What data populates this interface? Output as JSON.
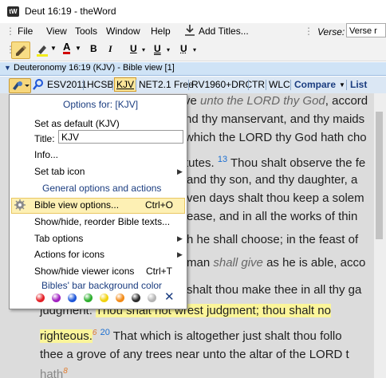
{
  "window": {
    "app_icon": "tW",
    "title": "Deut 16:19 - theWord"
  },
  "menu": {
    "file": "File",
    "view": "View",
    "tools": "Tools",
    "window": "Window",
    "help": "Help",
    "add_titles": "Add Titles...",
    "verse_label": "Verse:",
    "verse_value": "Verse r"
  },
  "toolbar": {
    "bold": "B",
    "italic": "I",
    "underline1": "U",
    "underline2": "U",
    "underline3": "U"
  },
  "doc_tab": {
    "title": "Deuteronomy 16:19 (KJV) - Bible view [1]"
  },
  "bibles": {
    "tabs": [
      "ESV2011",
      "HCSB",
      "KJV",
      "NET2.1 Free",
      "RV1960+DRC",
      "TR",
      "WLC"
    ],
    "active": "KJV",
    "compare": "Compare",
    "list": "List"
  },
  "reading": {
    "l1a": "ve ",
    "l1b": "unto the LORD thy God",
    "l1c": ", accord",
    "l2": "nd thy manservant, and thy maids",
    "l3": "which the LORD thy God hath cho",
    "l4a": "tutes. ",
    "l4n": "13",
    "l4b": " Thou shalt observe the fe",
    "l5": "and thy son, and thy daughter, a",
    "l6": "ven days shalt thou keep a solem",
    "l7": "ease, and in all the works of thin",
    "l8": "h he shall choose; in the feast of",
    "l9a": "man ",
    "l9b": "shall give",
    "l9c": " as he is able, acco",
    "l10": "shalt thou make thee in all thy ga",
    "l11a": "judgment. ",
    "l11b": "Thou shalt not wrest judgment; thou shalt no",
    "l12a": "righteous.",
    "l12s": "6",
    "l12b": " That which is altogether just shalt thou follo",
    "l12n": "20",
    "l13": "thee a grove of any trees near unto the altar of the LORD t",
    "l14a": "hath",
    "l14s": "8"
  },
  "popup": {
    "header": "Options for: [KJV]",
    "set_default": "Set as default (KJV)",
    "title_label": "Title:",
    "title_value": "KJV",
    "info": "Info...",
    "set_tab_icon": "Set tab icon",
    "general_header": "General options and actions",
    "bible_view_options": "Bible view options...",
    "bible_view_shortcut": "Ctrl+O",
    "show_hide_reorder": "Show/hide, reorder Bible texts...",
    "tab_options": "Tab options",
    "actions_for_icons": "Actions for icons",
    "show_hide_viewer": "Show/hide viewer icons",
    "show_hide_viewer_shortcut": "Ctrl+T",
    "bar_color_header": "Bibles' bar background color",
    "colors": [
      "#e41f26",
      "#a020c0",
      "#1e56d8",
      "#2dae2d",
      "#f1d20d",
      "#f28a17",
      "#2a2a2a",
      "#b4b4b4"
    ],
    "clear_color": "✕"
  }
}
